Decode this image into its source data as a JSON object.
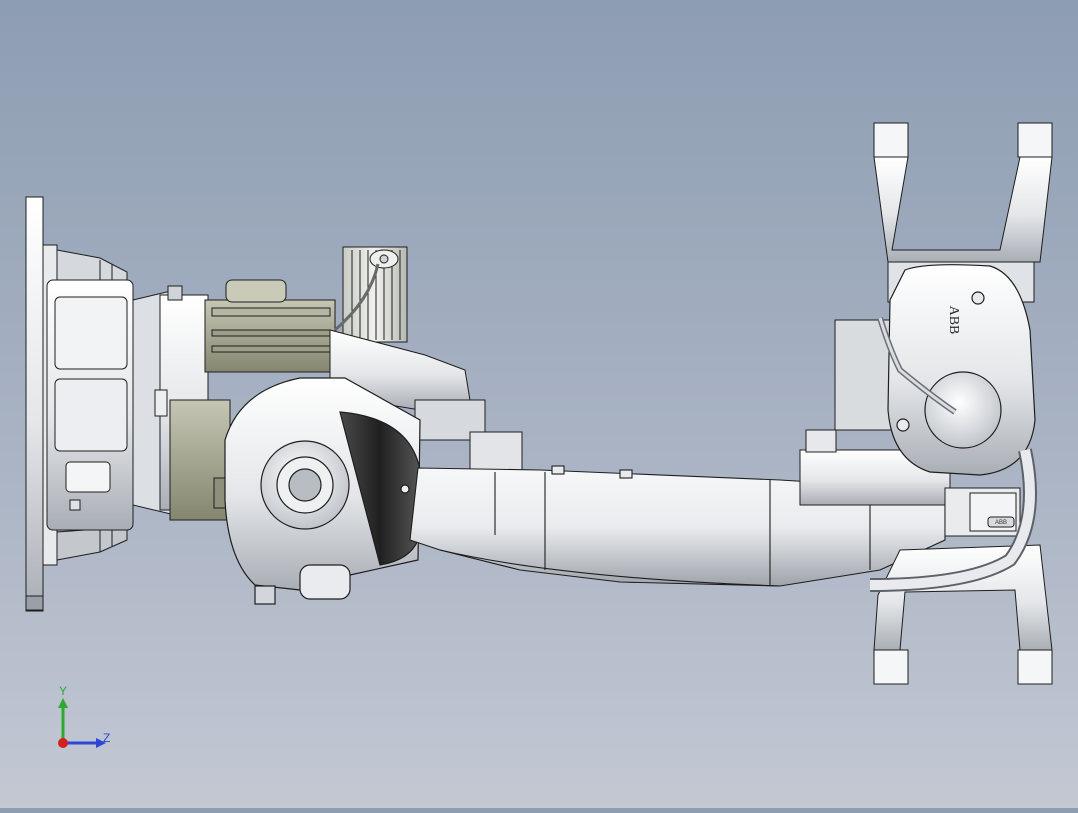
{
  "model": {
    "logo_text": "ABB",
    "part_label": "ABB",
    "colors": {
      "background_top": "#8d9db2",
      "background_bottom": "#c3c8d3",
      "body": "#eceef0",
      "shade": "#b9bec4",
      "edge": "#1e1e1e",
      "dark": "#3b3b3b",
      "olive": "#9a9b86"
    }
  },
  "triad": {
    "y_label": "Y",
    "z_label": "Z",
    "y_color": "#2fa82f",
    "z_color": "#2f45d8",
    "x_color": "#d42020"
  }
}
